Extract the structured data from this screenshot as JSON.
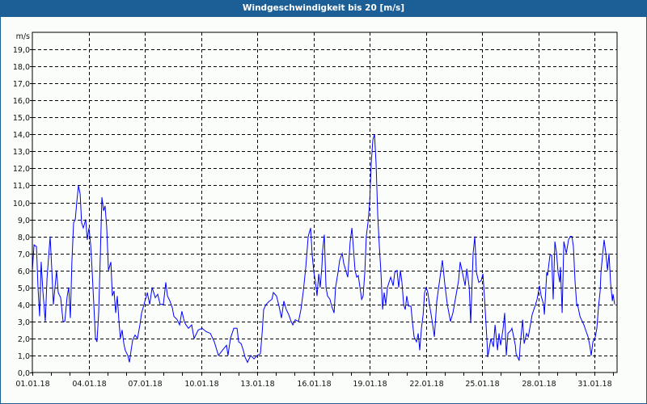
{
  "window": {
    "title": "Windgeschwindigkeit bis 20 [m/s]"
  },
  "colors": {
    "titlebar": "#1b5f96",
    "series": "#0000ff",
    "grid": "#000000"
  },
  "chart_data": {
    "type": "line",
    "title": "Windgeschwindigkeit bis 20 [m/s]",
    "ylabel": "m/s",
    "xlabel": "",
    "ylim": [
      0,
      20
    ],
    "xlim_days": [
      0,
      31.2
    ],
    "grid": true,
    "y_ticks": [
      "0,0",
      "1,0",
      "2,0",
      "3,0",
      "4,0",
      "5,0",
      "6,0",
      "7,0",
      "8,0",
      "9,0",
      "10,0",
      "11,0",
      "12,0",
      "13,0",
      "14,0",
      "15,0",
      "16,0",
      "17,0",
      "18,0",
      "19,0"
    ],
    "x_ticks": [
      {
        "day": 0,
        "label": "01.01.18"
      },
      {
        "day": 3,
        "label": "04.01.18"
      },
      {
        "day": 6,
        "label": "07.01.18"
      },
      {
        "day": 9,
        "label": "10.01.18"
      },
      {
        "day": 12,
        "label": "13.01.18"
      },
      {
        "day": 15,
        "label": "16.01.18"
      },
      {
        "day": 18,
        "label": "19.01.18"
      },
      {
        "day": 21,
        "label": "22.01.18"
      },
      {
        "day": 24,
        "label": "25.01.18"
      },
      {
        "day": 27,
        "label": "28.01.18"
      },
      {
        "day": 30,
        "label": "31.01.18"
      }
    ],
    "series": [
      {
        "name": "Windgeschwindigkeit",
        "points": [
          [
            0,
            6.0
          ],
          [
            0.09,
            7.5
          ],
          [
            0.22,
            7.4
          ],
          [
            0.3,
            5.0
          ],
          [
            0.39,
            3.3
          ],
          [
            0.47,
            6.5
          ],
          [
            0.56,
            4.8
          ],
          [
            0.69,
            3.0
          ],
          [
            0.78,
            5.5
          ],
          [
            0.95,
            8.0
          ],
          [
            1.04,
            6.0
          ],
          [
            1.12,
            4.0
          ],
          [
            1.21,
            5.0
          ],
          [
            1.29,
            6.0
          ],
          [
            1.38,
            4.7
          ],
          [
            1.51,
            4.4
          ],
          [
            1.64,
            3.0
          ],
          [
            1.73,
            3.0
          ],
          [
            1.86,
            4.5
          ],
          [
            1.94,
            5.0
          ],
          [
            2.03,
            3.2
          ],
          [
            2.11,
            6.5
          ],
          [
            2.2,
            8.8
          ],
          [
            2.29,
            9.0
          ],
          [
            2.37,
            10.0
          ],
          [
            2.46,
            11.0
          ],
          [
            2.55,
            10.5
          ],
          [
            2.63,
            8.8
          ],
          [
            2.72,
            8.5
          ],
          [
            2.85,
            9.0
          ],
          [
            2.93,
            7.8
          ],
          [
            3.02,
            8.5
          ],
          [
            3.11,
            7.5
          ],
          [
            3.19,
            6.0
          ],
          [
            3.28,
            4.0
          ],
          [
            3.37,
            2.0
          ],
          [
            3.45,
            1.8
          ],
          [
            3.54,
            3.5
          ],
          [
            3.63,
            7.0
          ],
          [
            3.71,
            10.3
          ],
          [
            3.8,
            9.5
          ],
          [
            3.88,
            9.8
          ],
          [
            3.97,
            8.5
          ],
          [
            4.06,
            6.0
          ],
          [
            4.19,
            6.5
          ],
          [
            4.27,
            4.5
          ],
          [
            4.36,
            4.8
          ],
          [
            4.45,
            3.5
          ],
          [
            4.53,
            4.5
          ],
          [
            4.62,
            3.0
          ],
          [
            4.7,
            2.0
          ],
          [
            4.79,
            2.5
          ],
          [
            4.88,
            1.7
          ],
          [
            4.96,
            1.3
          ],
          [
            5.09,
            1.0
          ],
          [
            5.18,
            0.6
          ],
          [
            5.27,
            1.3
          ],
          [
            5.35,
            1.9
          ],
          [
            5.48,
            2.2
          ],
          [
            5.61,
            2.0
          ],
          [
            5.74,
            2.8
          ],
          [
            5.83,
            3.5
          ],
          [
            5.96,
            4.0
          ],
          [
            6.13,
            4.7
          ],
          [
            6.26,
            4.0
          ],
          [
            6.39,
            5.0
          ],
          [
            6.56,
            4.4
          ],
          [
            6.69,
            4.6
          ],
          [
            6.82,
            4.0
          ],
          [
            6.99,
            4.0
          ],
          [
            7.12,
            5.3
          ],
          [
            7.21,
            4.5
          ],
          [
            7.34,
            4.2
          ],
          [
            7.47,
            3.8
          ],
          [
            7.55,
            3.3
          ],
          [
            7.73,
            3.1
          ],
          [
            7.86,
            2.8
          ],
          [
            7.98,
            3.6
          ],
          [
            8.11,
            3.0
          ],
          [
            8.2,
            2.8
          ],
          [
            8.33,
            2.6
          ],
          [
            8.5,
            2.8
          ],
          [
            8.63,
            2.0
          ],
          [
            8.85,
            2.5
          ],
          [
            9.06,
            2.6
          ],
          [
            9.28,
            2.4
          ],
          [
            9.5,
            2.3
          ],
          [
            9.71,
            1.8
          ],
          [
            9.93,
            1.0
          ],
          [
            10.14,
            1.3
          ],
          [
            10.36,
            1.6
          ],
          [
            10.44,
            1.0
          ],
          [
            10.57,
            2.0
          ],
          [
            10.75,
            2.6
          ],
          [
            10.92,
            2.6
          ],
          [
            11.01,
            1.8
          ],
          [
            11.14,
            1.7
          ],
          [
            11.26,
            1.3
          ],
          [
            11.35,
            0.9
          ],
          [
            11.48,
            0.6
          ],
          [
            11.65,
            1.0
          ],
          [
            11.83,
            0.8
          ],
          [
            12.0,
            1.0
          ],
          [
            12.17,
            1.1
          ],
          [
            12.26,
            2.3
          ],
          [
            12.34,
            3.7
          ],
          [
            12.47,
            4.0
          ],
          [
            12.65,
            4.2
          ],
          [
            12.78,
            4.3
          ],
          [
            12.86,
            4.7
          ],
          [
            13.03,
            4.5
          ],
          [
            13.16,
            3.9
          ],
          [
            13.29,
            3.2
          ],
          [
            13.42,
            4.2
          ],
          [
            13.55,
            3.7
          ],
          [
            13.68,
            3.4
          ],
          [
            13.81,
            3.0
          ],
          [
            13.9,
            2.8
          ],
          [
            14.03,
            3.1
          ],
          [
            14.2,
            3.0
          ],
          [
            14.33,
            3.7
          ],
          [
            14.46,
            4.8
          ],
          [
            14.59,
            6.2
          ],
          [
            14.72,
            8.0
          ],
          [
            14.85,
            8.5
          ],
          [
            14.93,
            6.9
          ],
          [
            15.02,
            5.9
          ],
          [
            15.11,
            5.3
          ],
          [
            15.19,
            4.5
          ],
          [
            15.28,
            5.8
          ],
          [
            15.36,
            5.0
          ],
          [
            15.45,
            6.2
          ],
          [
            15.49,
            7.2
          ],
          [
            15.58,
            8.1
          ],
          [
            15.67,
            5.0
          ],
          [
            15.75,
            4.5
          ],
          [
            15.88,
            4.3
          ],
          [
            15.97,
            3.9
          ],
          [
            16.1,
            3.5
          ],
          [
            16.18,
            5.0
          ],
          [
            16.31,
            5.9
          ],
          [
            16.4,
            6.6
          ],
          [
            16.53,
            7.0
          ],
          [
            16.62,
            6.4
          ],
          [
            16.75,
            5.9
          ],
          [
            16.83,
            5.6
          ],
          [
            16.96,
            7.7
          ],
          [
            17.05,
            8.5
          ],
          [
            17.13,
            7.3
          ],
          [
            17.22,
            6.0
          ],
          [
            17.31,
            5.6
          ],
          [
            17.39,
            5.7
          ],
          [
            17.48,
            5.0
          ],
          [
            17.57,
            4.3
          ],
          [
            17.65,
            4.5
          ],
          [
            17.74,
            5.9
          ],
          [
            17.82,
            8.0
          ],
          [
            17.91,
            8.8
          ],
          [
            18.0,
            10.0
          ],
          [
            18.08,
            12.3
          ],
          [
            18.17,
            13.7
          ],
          [
            18.26,
            14.0
          ],
          [
            18.34,
            12.3
          ],
          [
            18.43,
            9.2
          ],
          [
            18.52,
            7.3
          ],
          [
            18.6,
            5.9
          ],
          [
            18.69,
            3.7
          ],
          [
            18.77,
            4.7
          ],
          [
            18.86,
            4.0
          ],
          [
            18.95,
            5.0
          ],
          [
            19.03,
            5.3
          ],
          [
            19.12,
            5.6
          ],
          [
            19.25,
            5.1
          ],
          [
            19.34,
            5.9
          ],
          [
            19.46,
            6.0
          ],
          [
            19.55,
            5.0
          ],
          [
            19.64,
            6.0
          ],
          [
            19.72,
            5.3
          ],
          [
            19.81,
            4.0
          ],
          [
            19.9,
            3.7
          ],
          [
            19.98,
            4.5
          ],
          [
            20.07,
            3.9
          ],
          [
            20.2,
            3.9
          ],
          [
            20.28,
            3.0
          ],
          [
            20.37,
            2.1
          ],
          [
            20.5,
            1.8
          ],
          [
            20.59,
            2.3
          ],
          [
            20.67,
            1.3
          ],
          [
            20.76,
            2.6
          ],
          [
            20.85,
            3.4
          ],
          [
            20.93,
            4.7
          ],
          [
            21.02,
            5.0
          ],
          [
            21.1,
            4.7
          ],
          [
            21.19,
            4.0
          ],
          [
            21.28,
            3.4
          ],
          [
            21.36,
            2.8
          ],
          [
            21.45,
            2.1
          ],
          [
            21.58,
            4.2
          ],
          [
            21.88,
            6.6
          ],
          [
            22.01,
            5.2
          ],
          [
            22.14,
            4.0
          ],
          [
            22.31,
            3.0
          ],
          [
            22.44,
            3.5
          ],
          [
            22.57,
            4.3
          ],
          [
            22.74,
            5.4
          ],
          [
            22.83,
            6.5
          ],
          [
            22.96,
            5.8
          ],
          [
            23.09,
            5.1
          ],
          [
            23.18,
            6.1
          ],
          [
            23.31,
            5.0
          ],
          [
            23.39,
            2.9
          ],
          [
            23.52,
            7.0
          ],
          [
            23.61,
            8.0
          ],
          [
            23.69,
            5.9
          ],
          [
            23.82,
            5.3
          ],
          [
            23.95,
            5.4
          ],
          [
            24.04,
            5.8
          ],
          [
            24.13,
            4.3
          ],
          [
            24.26,
            1.8
          ],
          [
            24.3,
            0.9
          ],
          [
            24.47,
            2.0
          ],
          [
            24.6,
            1.5
          ],
          [
            24.69,
            2.8
          ],
          [
            24.82,
            1.3
          ],
          [
            24.9,
            2.3
          ],
          [
            24.99,
            1.6
          ],
          [
            25.12,
            2.6
          ],
          [
            25.2,
            3.5
          ],
          [
            25.29,
            1.0
          ],
          [
            25.38,
            2.3
          ],
          [
            25.55,
            2.5
          ],
          [
            25.59,
            2.6
          ],
          [
            25.77,
            1.6
          ],
          [
            25.81,
            1.1
          ],
          [
            25.98,
            0.7
          ],
          [
            26.03,
            1.6
          ],
          [
            26.16,
            3.1
          ],
          [
            26.24,
            1.7
          ],
          [
            26.37,
            2.3
          ],
          [
            26.46,
            2.1
          ],
          [
            26.59,
            2.9
          ],
          [
            26.67,
            3.4
          ],
          [
            26.85,
            4.0
          ],
          [
            26.93,
            4.3
          ],
          [
            27.06,
            5.1
          ],
          [
            27.15,
            4.5
          ],
          [
            27.28,
            4.0
          ],
          [
            27.32,
            3.4
          ],
          [
            27.45,
            5.9
          ],
          [
            27.49,
            5.7
          ],
          [
            27.62,
            6.9
          ],
          [
            27.71,
            6.9
          ],
          [
            27.79,
            4.3
          ],
          [
            27.88,
            7.7
          ],
          [
            27.97,
            7.0
          ],
          [
            28.05,
            5.9
          ],
          [
            28.14,
            5.3
          ],
          [
            28.18,
            6.2
          ],
          [
            28.27,
            3.5
          ],
          [
            28.36,
            7.7
          ],
          [
            28.49,
            7.0
          ],
          [
            28.61,
            7.8
          ],
          [
            28.7,
            8.0
          ],
          [
            28.79,
            8.0
          ],
          [
            28.87,
            7.4
          ],
          [
            28.96,
            5.3
          ],
          [
            29.05,
            3.9
          ],
          [
            29.09,
            4.0
          ],
          [
            29.22,
            3.3
          ],
          [
            29.26,
            3.2
          ],
          [
            29.43,
            2.8
          ],
          [
            29.52,
            2.5
          ],
          [
            29.65,
            2.1
          ],
          [
            29.74,
            1.6
          ],
          [
            29.82,
            1.0
          ],
          [
            29.91,
            1.8
          ],
          [
            30.04,
            2.1
          ],
          [
            30.12,
            2.6
          ],
          [
            30.21,
            3.9
          ],
          [
            30.3,
            4.8
          ],
          [
            30.34,
            5.9
          ],
          [
            30.47,
            7.4
          ],
          [
            30.51,
            7.8
          ],
          [
            30.6,
            7.0
          ],
          [
            30.69,
            6.0
          ],
          [
            30.77,
            7.0
          ],
          [
            30.86,
            5.2
          ],
          [
            30.95,
            4.2
          ],
          [
            30.99,
            4.6
          ],
          [
            31.07,
            4.0
          ]
        ]
      }
    ]
  }
}
